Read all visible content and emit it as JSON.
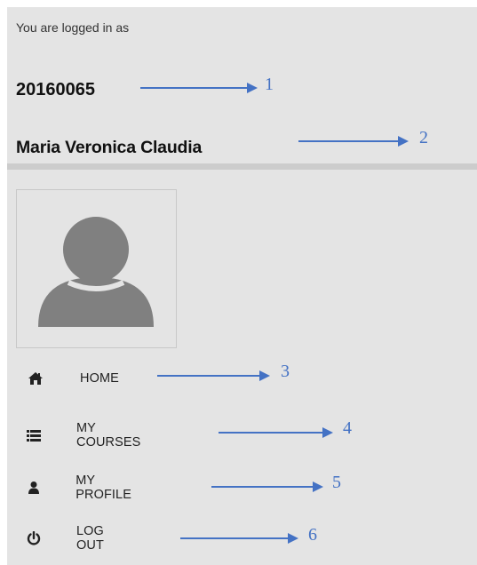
{
  "user_block": {
    "logged_in_label": "You are logged in as",
    "user_id": "20160065",
    "user_name": "Maria Veronica Claudia"
  },
  "avatar": {
    "icon": "default-user-avatar-icon"
  },
  "menu": {
    "items": [
      {
        "label": "HOME",
        "icon": "home-icon"
      },
      {
        "label": "MY COURSES",
        "icon": "list-icon"
      },
      {
        "label": "MY PROFILE",
        "icon": "user-icon"
      },
      {
        "label": "LOG OUT",
        "icon": "power-icon"
      }
    ]
  },
  "annotations": [
    "1",
    "2",
    "3",
    "4",
    "5",
    "6"
  ],
  "colors": {
    "panel_background": "#e4e4e4",
    "divider": "#cccccc",
    "annotation_blue": "#4472c4",
    "avatar_gray": "#808080"
  }
}
